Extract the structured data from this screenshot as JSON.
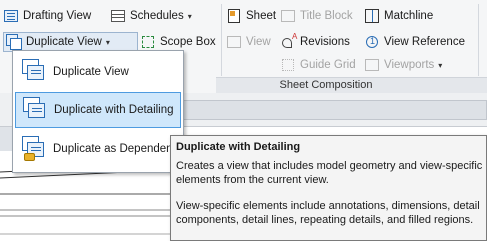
{
  "ribbon": {
    "left_buttons": {
      "drafting_view": "Drafting View",
      "duplicate_view": "Duplicate View",
      "schedules": "Schedules",
      "scope_box": "Scope Box",
      "view": "View"
    },
    "sheet_composition": {
      "sheet": "Sheet",
      "title_block": "Title Block",
      "matchline": "Matchline",
      "revisions": "Revisions",
      "view_reference": "View Reference",
      "guide_grid": "Guide Grid",
      "viewports": "Viewports",
      "panel_title": "Sheet Composition"
    }
  },
  "dropdown": {
    "items": [
      {
        "label": "Duplicate View"
      },
      {
        "label": "Duplicate with Detailing"
      },
      {
        "label": "Duplicate as Dependent"
      }
    ]
  },
  "tooltip": {
    "title": "Duplicate with Detailing",
    "body1": "Creates a view that includes model geometry and view-specific elements from the current view.",
    "body2": "View-specific elements include annotations, dimensions, detail components, detail lines, repeating details, and filled regions."
  },
  "colors": {
    "ribbon_bg": "#f5f6f7",
    "hover_bg": "#cfe7fb",
    "hover_border": "#4d9be0",
    "tooltip_bg": "#f4f4f4",
    "accent_blue": "#2a6db5"
  }
}
